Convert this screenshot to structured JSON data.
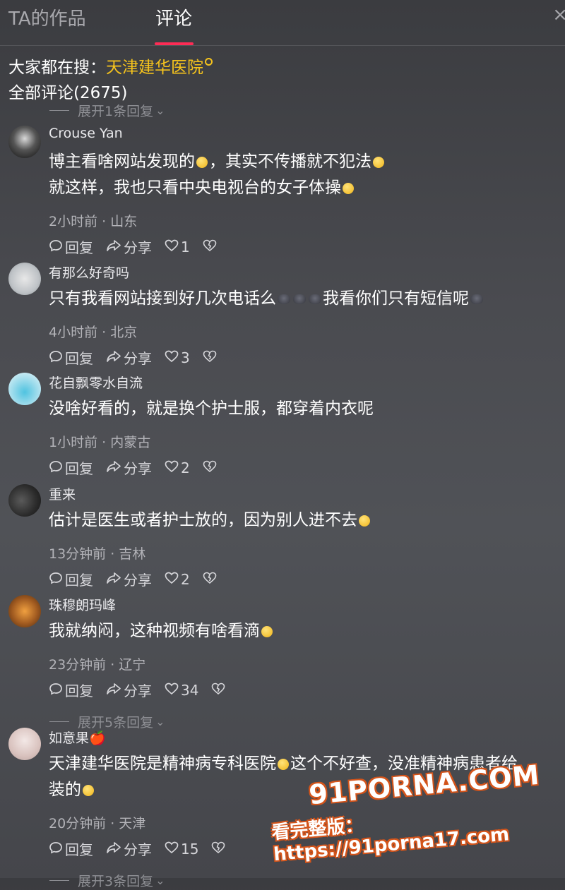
{
  "tabs": {
    "works": "TA的作品",
    "comments": "评论",
    "close": "×"
  },
  "search": {
    "prefix": "大家都在搜：",
    "query": "天津建华医院"
  },
  "comments_header": {
    "count_label": "全部评论(2675)"
  },
  "expand_top": "展开1条回复",
  "actions": {
    "reply": "回复",
    "share": "分享"
  },
  "comments": [
    {
      "username": "Crouse Yan",
      "lines": [
        [
          {
            "t": "博主看啥网站发现的"
          },
          {
            "e": "yellow"
          },
          {
            "t": "，其实不传播就不犯法"
          },
          {
            "e": "yellow"
          }
        ],
        [
          {
            "t": "就这样，我也只看中央电视台的女子体操"
          },
          {
            "e": "yellow"
          }
        ]
      ],
      "meta": "2小时前 · 山东",
      "likes": "1"
    },
    {
      "username": "有那么好奇吗",
      "lines": [
        [
          {
            "t": "只有我看网站接到好几次电话么"
          },
          {
            "e": "dark"
          },
          {
            "e": "dark"
          },
          {
            "e": "dark"
          },
          {
            "t": "我看你们只有短信呢"
          },
          {
            "e": "dark"
          }
        ]
      ],
      "meta": "4小时前 · 北京",
      "likes": "3"
    },
    {
      "username": "花自飘零水自流",
      "lines": [
        [
          {
            "t": "没啥好看的，就是换个护士服，都穿着内衣呢"
          }
        ]
      ],
      "meta": "1小时前 · 内蒙古",
      "likes": "2"
    },
    {
      "username": "重来",
      "lines": [
        [
          {
            "t": "估计是医生或者护士放的，因为别人进不去"
          },
          {
            "e": "yellow"
          }
        ]
      ],
      "meta": "13分钟前 · 吉林",
      "likes": "2"
    },
    {
      "username": "珠穆朗玛峰",
      "lines": [
        [
          {
            "t": "我就纳闷，这种视频有啥看滴"
          },
          {
            "e": "yellow"
          }
        ]
      ],
      "meta": "23分钟前 · 辽宁",
      "likes": "34",
      "expand": "展开5条回复"
    },
    {
      "username": "如意果🍎",
      "lines": [
        [
          {
            "t": "天津建华医院是精神病专科医院"
          },
          {
            "e": "yellow"
          },
          {
            "t": "这个不好查，没准精神病患者给"
          }
        ],
        [
          {
            "t": "装的"
          },
          {
            "e": "yellow"
          }
        ]
      ],
      "meta": "20分钟前 · 天津",
      "likes": "15",
      "expand": "展开3条回复"
    }
  ],
  "watermark": {
    "logo": "91PORNA.COM",
    "url": "看完整版：https://91porna17.com"
  },
  "colors": {
    "accent": "#fe2c55",
    "search_link": "#f5c31d",
    "meta": "#b3b3b8"
  }
}
